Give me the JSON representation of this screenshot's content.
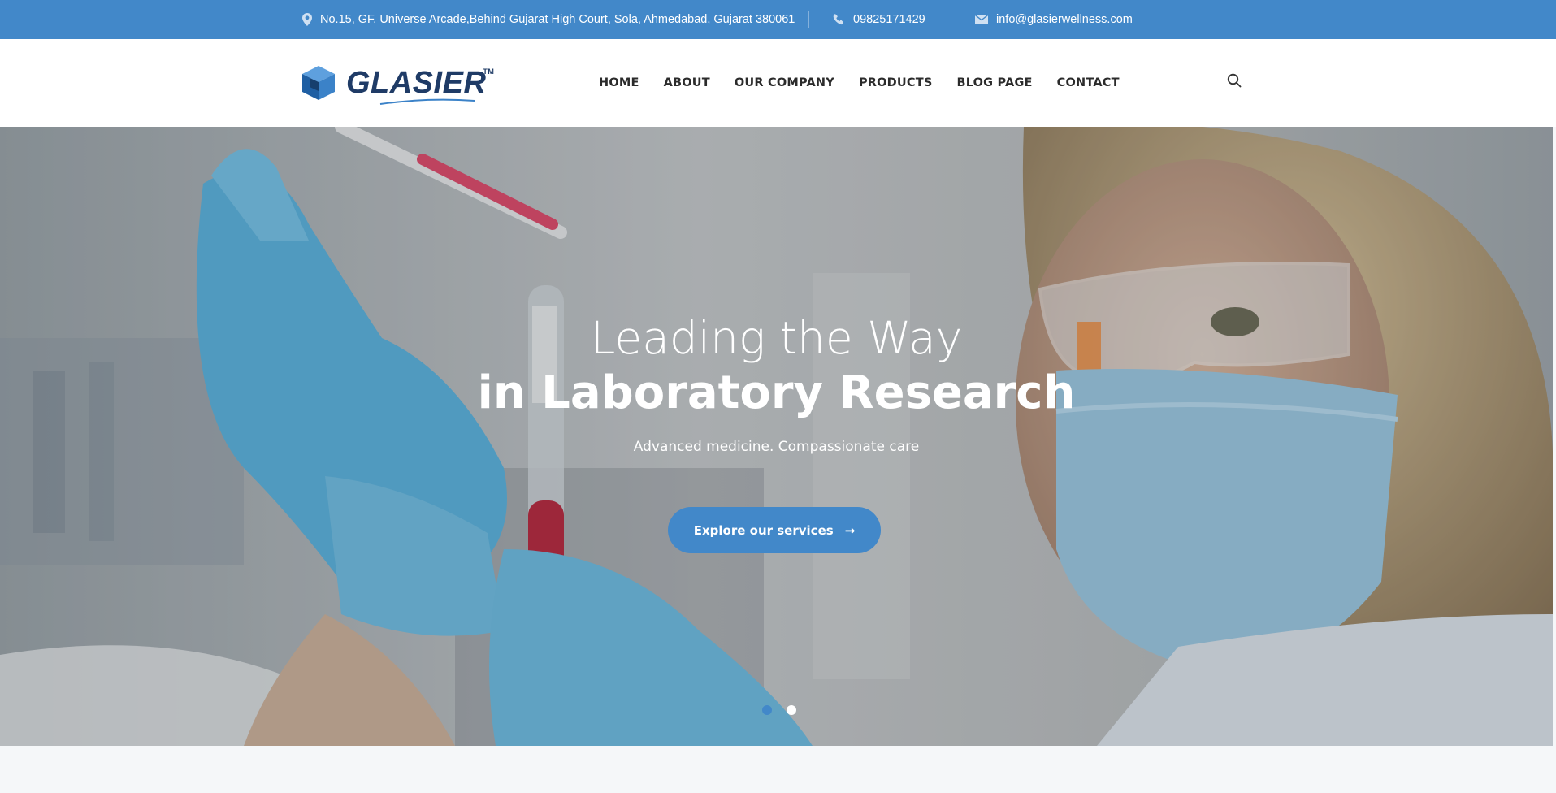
{
  "topbar": {
    "address": "No.15, GF, Universe Arcade,Behind Gujarat High Court, Sola, Ahmedabad, Gujarat 380061",
    "phone": "09825171429",
    "email": "info@glasierwellness.com",
    "icons": [
      "map-pin-icon",
      "phone-icon",
      "mail-icon"
    ]
  },
  "header": {
    "logo_text": "GLASIER",
    "logo_tm": "TM",
    "nav": [
      {
        "label": "HOME"
      },
      {
        "label": "ABOUT"
      },
      {
        "label": "OUR COMPANY"
      },
      {
        "label": "PRODUCTS"
      },
      {
        "label": "BLOG PAGE"
      },
      {
        "label": "CONTACT"
      }
    ],
    "search_icon": "search-icon"
  },
  "hero": {
    "title_line1": "Leading the Way",
    "title_line2": "in Laboratory Research",
    "subtitle": "Advanced medicine. Compassionate care",
    "button_label": "Explore our services",
    "button_icon": "arrow-right-icon",
    "slides_count": 2,
    "active_slide": 1
  },
  "colors": {
    "brand_blue": "#4288c9",
    "logo_navy": "#1f3b66",
    "nav_text": "#2b2b2b"
  }
}
